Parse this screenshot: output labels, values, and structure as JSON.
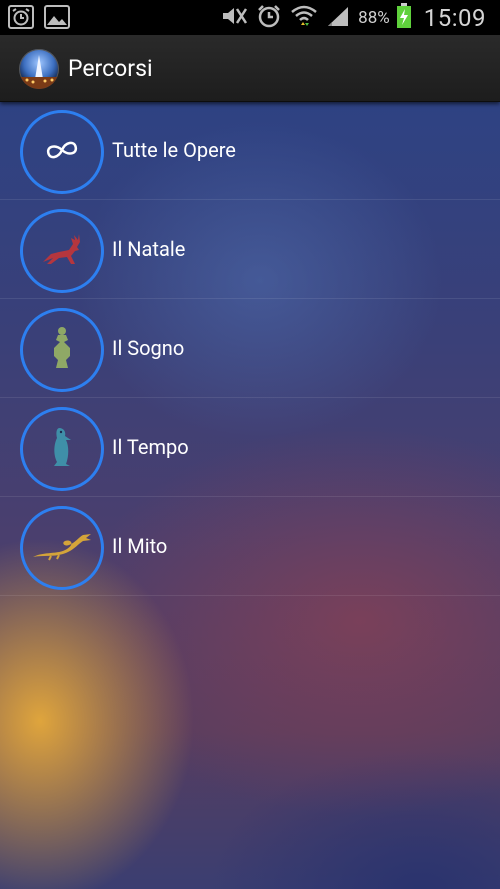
{
  "status_bar": {
    "battery_percent": "88%",
    "time": "15:09",
    "icons": [
      "alarm-clock-icon",
      "image-icon",
      "mute-icon",
      "alarm-icon",
      "wifi-icon",
      "signal-icon",
      "battery-charging-icon"
    ]
  },
  "action_bar": {
    "title": "Percorsi",
    "app_icon": "app-logo-icon"
  },
  "list": {
    "items": [
      {
        "label": "Tutte le Opere",
        "icon": "infinity-icon",
        "icon_color": "#ffffff"
      },
      {
        "label": "Il Natale",
        "icon": "reindeer-icon",
        "icon_color": "#b5363e"
      },
      {
        "label": "Il Sogno",
        "icon": "vase-figure-icon",
        "icon_color": "#8fa866"
      },
      {
        "label": "Il Tempo",
        "icon": "penguin-icon",
        "icon_color": "#3f8fa8"
      },
      {
        "label": "Il Mito",
        "icon": "dragon-icon",
        "icon_color": "#d4a43a"
      }
    ]
  },
  "colors": {
    "accent_circle": "#2d7ff0",
    "action_bar": "#222222",
    "status_bar": "#000000"
  }
}
